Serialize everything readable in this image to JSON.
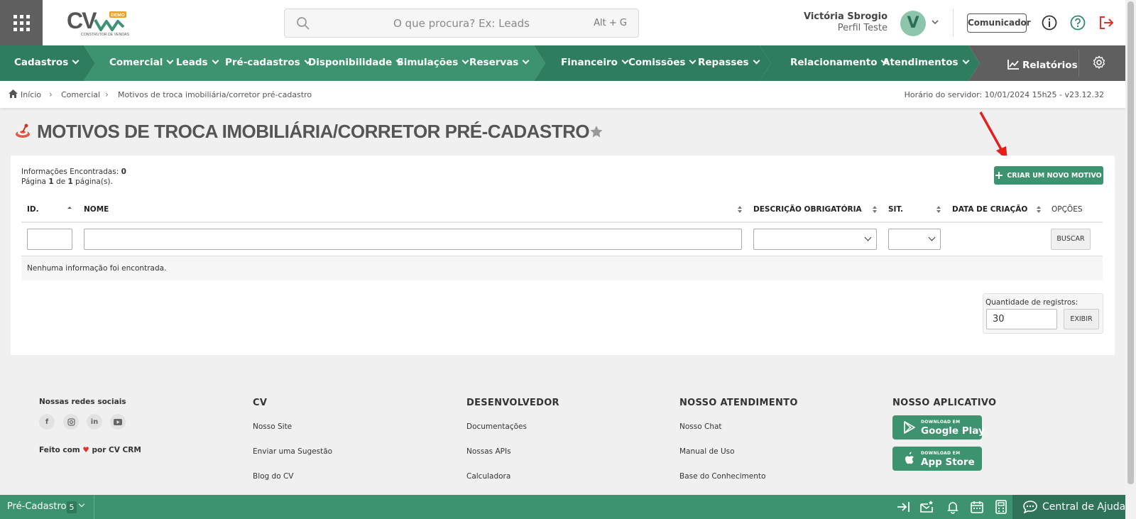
{
  "header": {
    "search_placeholder": "O que procura? Ex: Leads",
    "search_shortcut": "Alt + G",
    "logo_text": "CV",
    "logo_badge": "DEMO",
    "logo_tagline": "CONSTRUTOR DE VENDAS",
    "user_name": "Victória Sbrogio",
    "user_profile": "Perfil Teste",
    "avatar_initial": "V",
    "comunicador_label": "Comunicador"
  },
  "nav": {
    "items": [
      {
        "label": "Cadastros"
      },
      {
        "label": "Comercial"
      },
      {
        "label": "Leads"
      },
      {
        "label": "Pré-cadastros"
      },
      {
        "label": "Disponibilidade"
      },
      {
        "label": "Simulações"
      },
      {
        "label": "Reservas"
      },
      {
        "label": "Financeiro"
      },
      {
        "label": "Comissões"
      },
      {
        "label": "Repasses"
      },
      {
        "label": "Relacionamento"
      },
      {
        "label": "Atendimentos"
      }
    ],
    "reports_label": "Relatórios",
    "colors": {
      "dark": "#2f7d5f",
      "mid": "#3d9370",
      "light": "#4ea07d",
      "gray": "#5f5f5f"
    }
  },
  "breadcrumb": {
    "items": [
      "Início",
      "Comercial",
      "Motivos de troca imobiliária/corretor pré-cadastro"
    ],
    "server_time": "Horário do servidor: 10/01/2024 15h25 - v23.12.32"
  },
  "page": {
    "title": "MOTIVOS DE TROCA IMOBILIÁRIA/CORRETOR PRÉ-CADASTRO",
    "info_found_label": "Informações Encontradas:",
    "info_found_value": "0",
    "page_label_prefix": "Página",
    "page_current": "1",
    "page_of": "de",
    "page_total": "1",
    "page_suffix": "página(s).",
    "create_button": "CRIAR UM NOVO MOTIVO",
    "columns": [
      "ID.",
      "NOME",
      "DESCRIÇÃO OBRIGATÓRIA",
      "SIT.",
      "DATA DE CRIAÇÃO",
      "OPÇÕES"
    ],
    "search_button": "BUSCAR",
    "empty_message": "Nenhuma informação foi encontrada.",
    "qty_label": "Quantidade de registros:",
    "qty_value": "30",
    "show_button": "EXIBIR",
    "accent": "#3d9370"
  },
  "footer": {
    "social_title": "Nossas redes sociais",
    "made_with_prefix": "Feito com",
    "made_with_suffix": "por CV CRM",
    "columns": [
      {
        "title": "CV",
        "links": [
          "Nosso Site",
          "Enviar uma Sugestão",
          "Blog do CV"
        ]
      },
      {
        "title": "DESENVOLVEDOR",
        "links": [
          "Documentações",
          "Nossas APIs",
          "Calculadora"
        ]
      },
      {
        "title": "NOSSO ATENDIMENTO",
        "links": [
          "Nosso Chat",
          "Manual de Uso",
          "Base do Conhecimento"
        ]
      }
    ],
    "app_title": "NOSSO APLICATIVO",
    "google_small": "DOWNLOAD EM",
    "google_big": "Google Play",
    "apple_small": "DOWNLOAD EM",
    "apple_big": "App Store"
  },
  "bottombar": {
    "pre_label": "Pré-Cadastro",
    "pre_count": "5",
    "help_label": "Central de Ajuda"
  }
}
